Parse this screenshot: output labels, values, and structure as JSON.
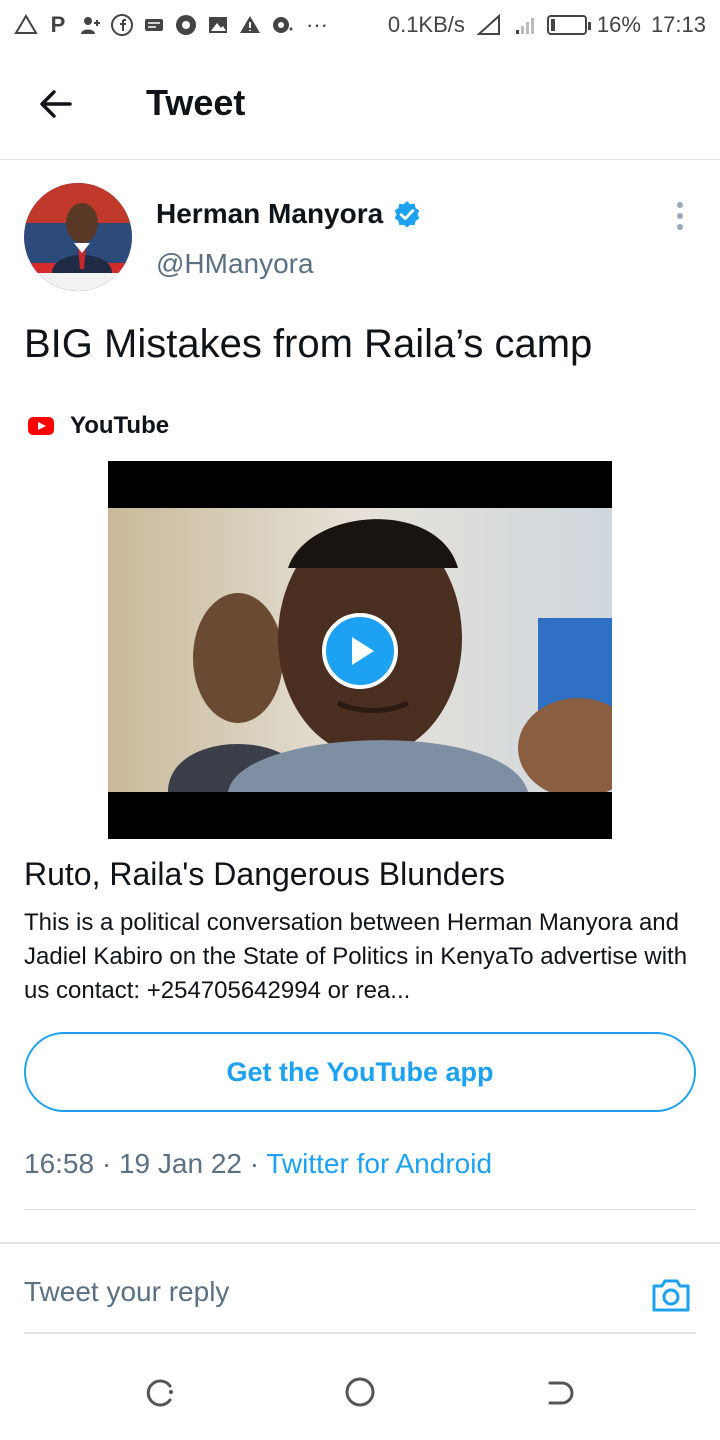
{
  "status_bar": {
    "net_speed": "0.1KB/s",
    "battery": "16%",
    "time": "17:13",
    "overflow": "···"
  },
  "header": {
    "title": "Tweet"
  },
  "tweet": {
    "author_name": "Herman Manyora",
    "author_handle": "@HManyora",
    "text": "BIG Mistakes from Raila’s camp",
    "card": {
      "source": "YouTube",
      "title": "Ruto, Raila's Dangerous Blunders",
      "description": "This is a political conversation between Herman Manyora and Jadiel Kabiro on the State of Politics in KenyaTo advertise with us contact: +254705642994 or rea...",
      "cta": "Get the YouTube app"
    },
    "time": "16:58",
    "date": "19 Jan 22",
    "client": "Twitter for Android"
  },
  "reply": {
    "placeholder": "Tweet your reply"
  },
  "colors": {
    "accent": "#1da1f2",
    "secondary_text": "#5b7083",
    "youtube_red": "#ff0000"
  },
  "icons": [
    "back-arrow-icon",
    "verified-badge-icon",
    "more-vertical-icon",
    "youtube-logo-icon",
    "play-icon",
    "camera-icon",
    "recents-icon",
    "home-icon",
    "back-icon"
  ]
}
